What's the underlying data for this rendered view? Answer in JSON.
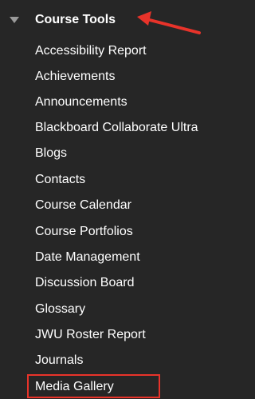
{
  "section": {
    "title": "Course Tools",
    "expanded": true
  },
  "items": [
    {
      "label": "Accessibility Report"
    },
    {
      "label": "Achievements"
    },
    {
      "label": "Announcements"
    },
    {
      "label": "Blackboard Collaborate Ultra"
    },
    {
      "label": "Blogs"
    },
    {
      "label": "Contacts"
    },
    {
      "label": "Course Calendar"
    },
    {
      "label": "Course Portfolios"
    },
    {
      "label": "Date Management"
    },
    {
      "label": "Discussion Board"
    },
    {
      "label": "Glossary"
    },
    {
      "label": "JWU Roster Report"
    },
    {
      "label": "Journals"
    },
    {
      "label": "Media Gallery"
    }
  ],
  "colors": {
    "background": "#262626",
    "text": "#ffffff",
    "annotation": "#e8332a",
    "caret": "#9a9a9a"
  },
  "icons": {
    "expand": "caret-down-icon",
    "annotation": "red-arrow-icon"
  }
}
